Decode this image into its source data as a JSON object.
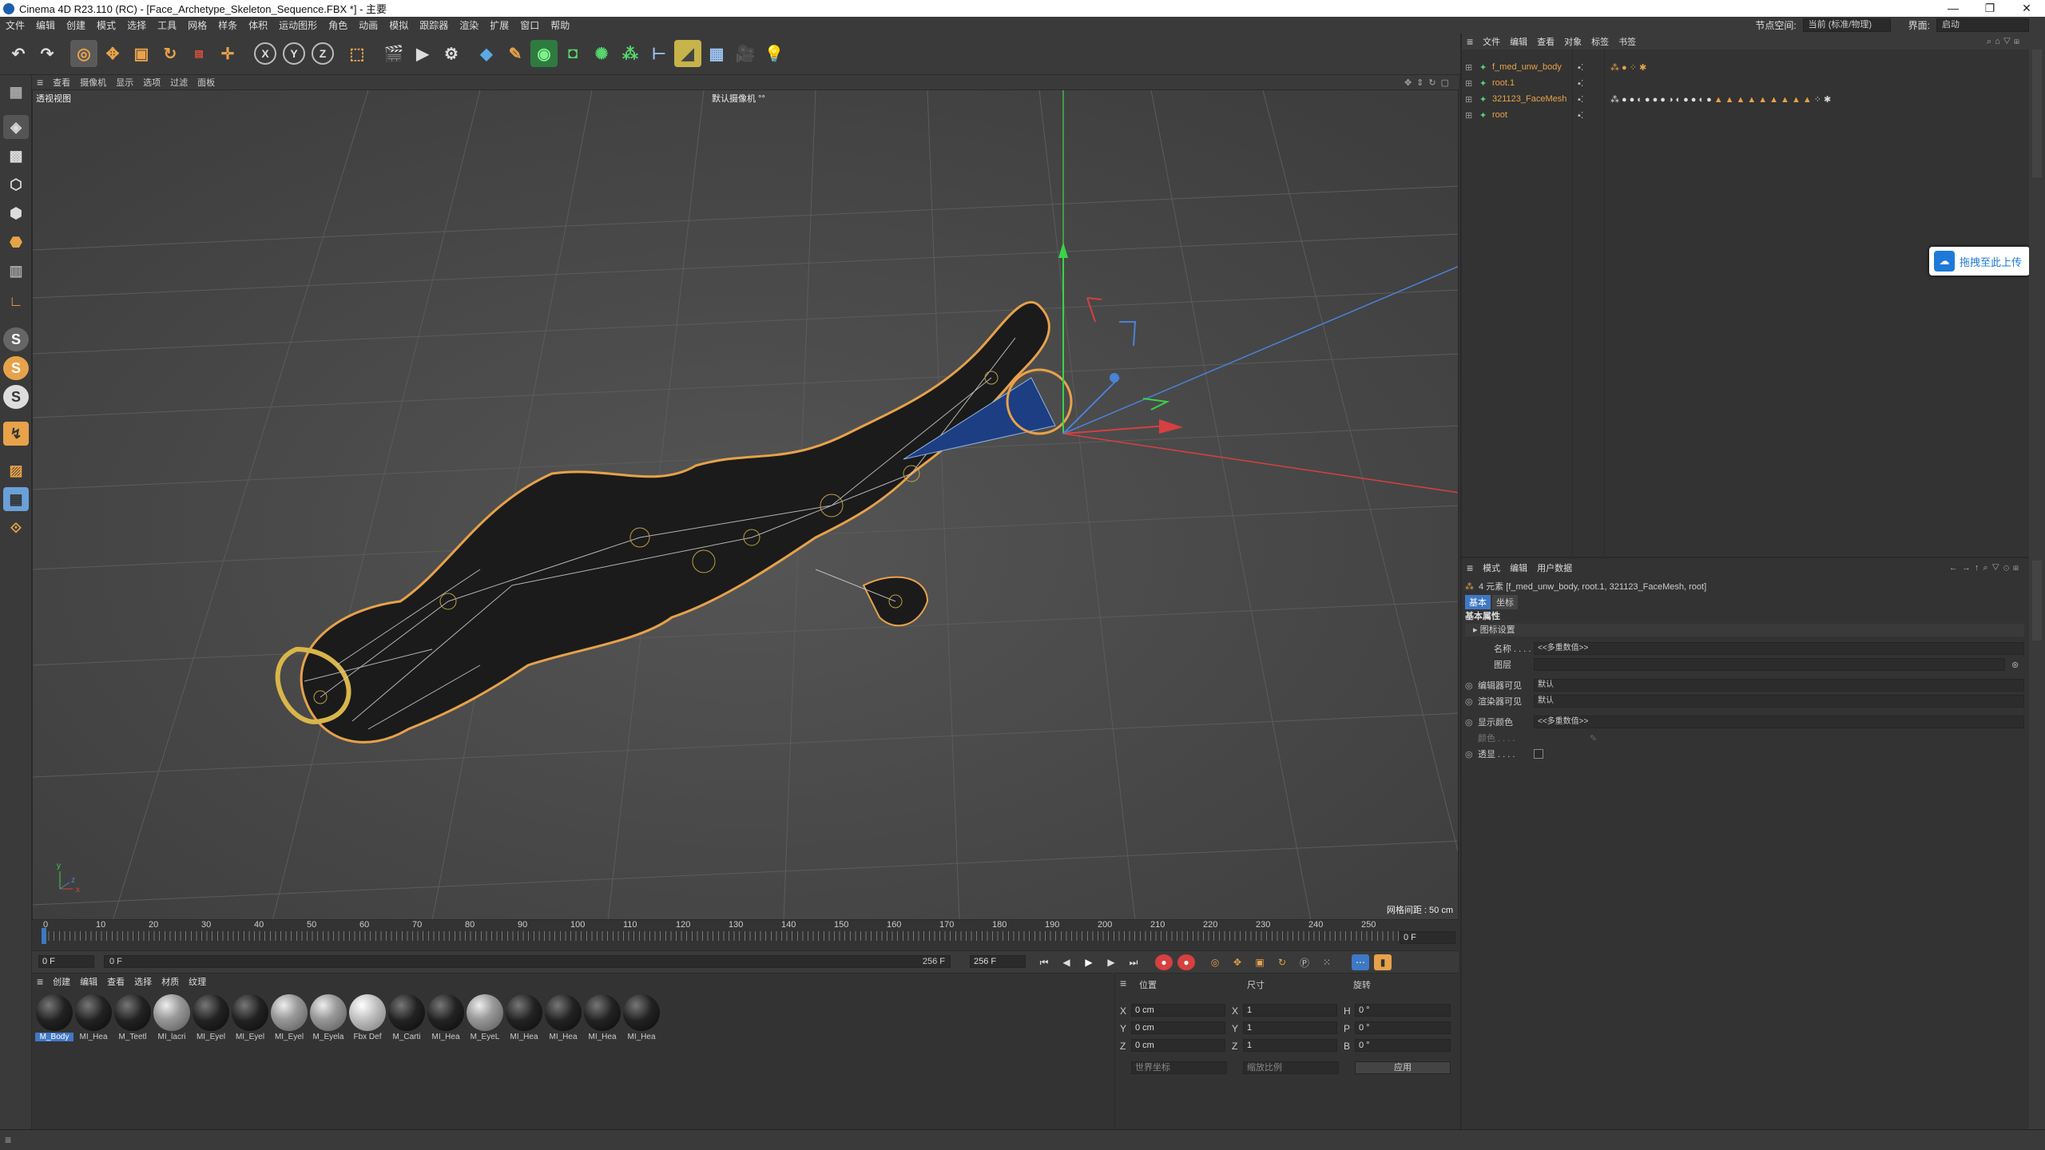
{
  "title": "Cinema 4D R23.110 (RC) - [Face_Archetype_Skeleton_Sequence.FBX *] - 主要",
  "window_buttons": [
    "—",
    "❐",
    "✕"
  ],
  "menu": [
    "文件",
    "编辑",
    "创建",
    "模式",
    "选择",
    "工具",
    "网格",
    "样条",
    "体积",
    "运动图形",
    "角色",
    "动画",
    "模拟",
    "跟踪器",
    "渲染",
    "扩展",
    "窗口",
    "帮助"
  ],
  "node_space_label": "节点空间:",
  "node_space_value": "当前 (标准/物理)",
  "interface_label": "界面:",
  "interface_value": "启动",
  "viewport_menu": [
    "查看",
    "摄像机",
    "显示",
    "选项",
    "过滤",
    "面板"
  ],
  "viewport_label": "透视视图",
  "camera_label": "默认摄像机 °°",
  "grid_spacing": "网格间距 : 50 cm",
  "timeline_ticks": [
    "0",
    "10",
    "20",
    "30",
    "40",
    "50",
    "60",
    "70",
    "80",
    "90",
    "100",
    "110",
    "120",
    "130",
    "140",
    "150",
    "160",
    "170",
    "180",
    "190",
    "200",
    "210",
    "220",
    "230",
    "240",
    "250"
  ],
  "current_frame": "0 F",
  "start_frame": "0 F",
  "range_start": "0 F",
  "range_end": "256 F",
  "end_frame": "256 F",
  "material_menu": [
    "创建",
    "编辑",
    "查看",
    "选择",
    "材质",
    "纹理"
  ],
  "materials": [
    {
      "label": "M_Body",
      "style": "dark",
      "selected": true
    },
    {
      "label": "MI_Hea",
      "style": "dark"
    },
    {
      "label": "M_Teetl",
      "style": "dark"
    },
    {
      "label": "MI_lacri",
      "style": "clear"
    },
    {
      "label": "MI_Eyel",
      "style": "dark"
    },
    {
      "label": "MI_Eyel",
      "style": "dark"
    },
    {
      "label": "MI_Eyel",
      "style": "clear"
    },
    {
      "label": "M_Eyela",
      "style": "clear"
    },
    {
      "label": "Fbx Def",
      "style": "light"
    },
    {
      "label": "M_Carti",
      "style": "dark"
    },
    {
      "label": "MI_Hea",
      "style": "dark"
    },
    {
      "label": "M_EyeL",
      "style": "clear"
    },
    {
      "label": "MI_Hea",
      "style": "dark"
    },
    {
      "label": "MI_Hea",
      "style": "dark"
    },
    {
      "label": "MI_Hea",
      "style": "dark"
    },
    {
      "label": "MI_Hea",
      "style": "dark"
    }
  ],
  "coord_headers": [
    "位置",
    "尺寸",
    "旋转"
  ],
  "coords": [
    {
      "axis": "X",
      "pos": "0 cm",
      "size_axis": "X",
      "size": "1",
      "rot_axis": "H",
      "rot": "0 °"
    },
    {
      "axis": "Y",
      "pos": "0 cm",
      "size_axis": "Y",
      "size": "1",
      "rot_axis": "P",
      "rot": "0 °"
    },
    {
      "axis": "Z",
      "pos": "0 cm",
      "size_axis": "Z",
      "size": "1",
      "rot_axis": "B",
      "rot": "0 °"
    }
  ],
  "coord_mode": "世界坐标",
  "scale_mode": "缩放比例",
  "apply_label": "应用",
  "object_menu": [
    "文件",
    "编辑",
    "查看",
    "对象",
    "标签",
    "书签"
  ],
  "objects": [
    {
      "name": "f_med_unw_body"
    },
    {
      "name": "root.1"
    },
    {
      "name": "321123_FaceMesh"
    },
    {
      "name": "root"
    }
  ],
  "upload_label": "拖拽至此上传",
  "attr_menu": [
    "模式",
    "编辑",
    "用户数据"
  ],
  "attr_summary": "4 元素 [f_med_unw_body, root.1, 321123_FaceMesh, root]",
  "attr_tabs": [
    "基本",
    "坐标"
  ],
  "attr_section": "基本属性",
  "attr_subsection": "图标设置",
  "attr_fields": [
    {
      "label": "名称 . . . . . .",
      "value": "<<多重数值>>"
    },
    {
      "label": "图层",
      "value": ""
    },
    {
      "label": "编辑器可见",
      "value": "默认"
    },
    {
      "label": "渲染器可见",
      "value": "默认"
    },
    {
      "label": "显示颜色",
      "value": "<<多重数值>>"
    },
    {
      "label": "颜色 . . . .",
      "value": ""
    },
    {
      "label": "透显 . . . .",
      "value": ""
    }
  ],
  "accent_color": "#e7a24a",
  "selection_color": "#3f78c4"
}
